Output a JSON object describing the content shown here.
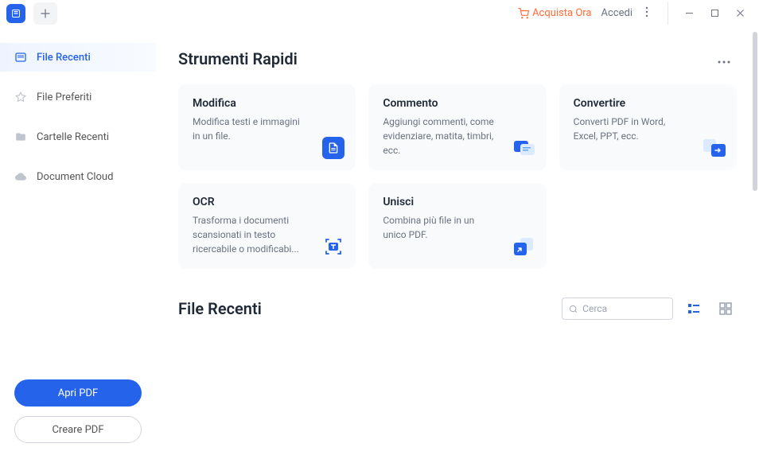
{
  "titlebar": {
    "buy_now": "Acquista Ora",
    "login": "Accedi"
  },
  "sidebar": {
    "items": [
      {
        "label": "File Recenti"
      },
      {
        "label": "File Preferiti"
      },
      {
        "label": "Cartelle Recenti"
      },
      {
        "label": "Document Cloud"
      }
    ],
    "open_pdf": "Apri PDF",
    "create_pdf": "Creare PDF"
  },
  "main": {
    "quick_tools_title": "Strumenti Rapidi",
    "tools": [
      {
        "title": "Modifica",
        "desc": "Modifica testi e immagini in un file."
      },
      {
        "title": "Commento",
        "desc": "Aggiungi commenti, come evidenziare, matita, timbri, ecc."
      },
      {
        "title": "Convertire",
        "desc": "Converti PDF in Word, Excel, PPT, ecc."
      },
      {
        "title": "OCR",
        "desc": "Trasforma i documenti scansionati in testo ricercabile o modificabi..."
      },
      {
        "title": "Unisci",
        "desc": "Combina più file in un unico PDF."
      }
    ],
    "recent_title": "File Recenti",
    "search_placeholder": "Cerca"
  }
}
